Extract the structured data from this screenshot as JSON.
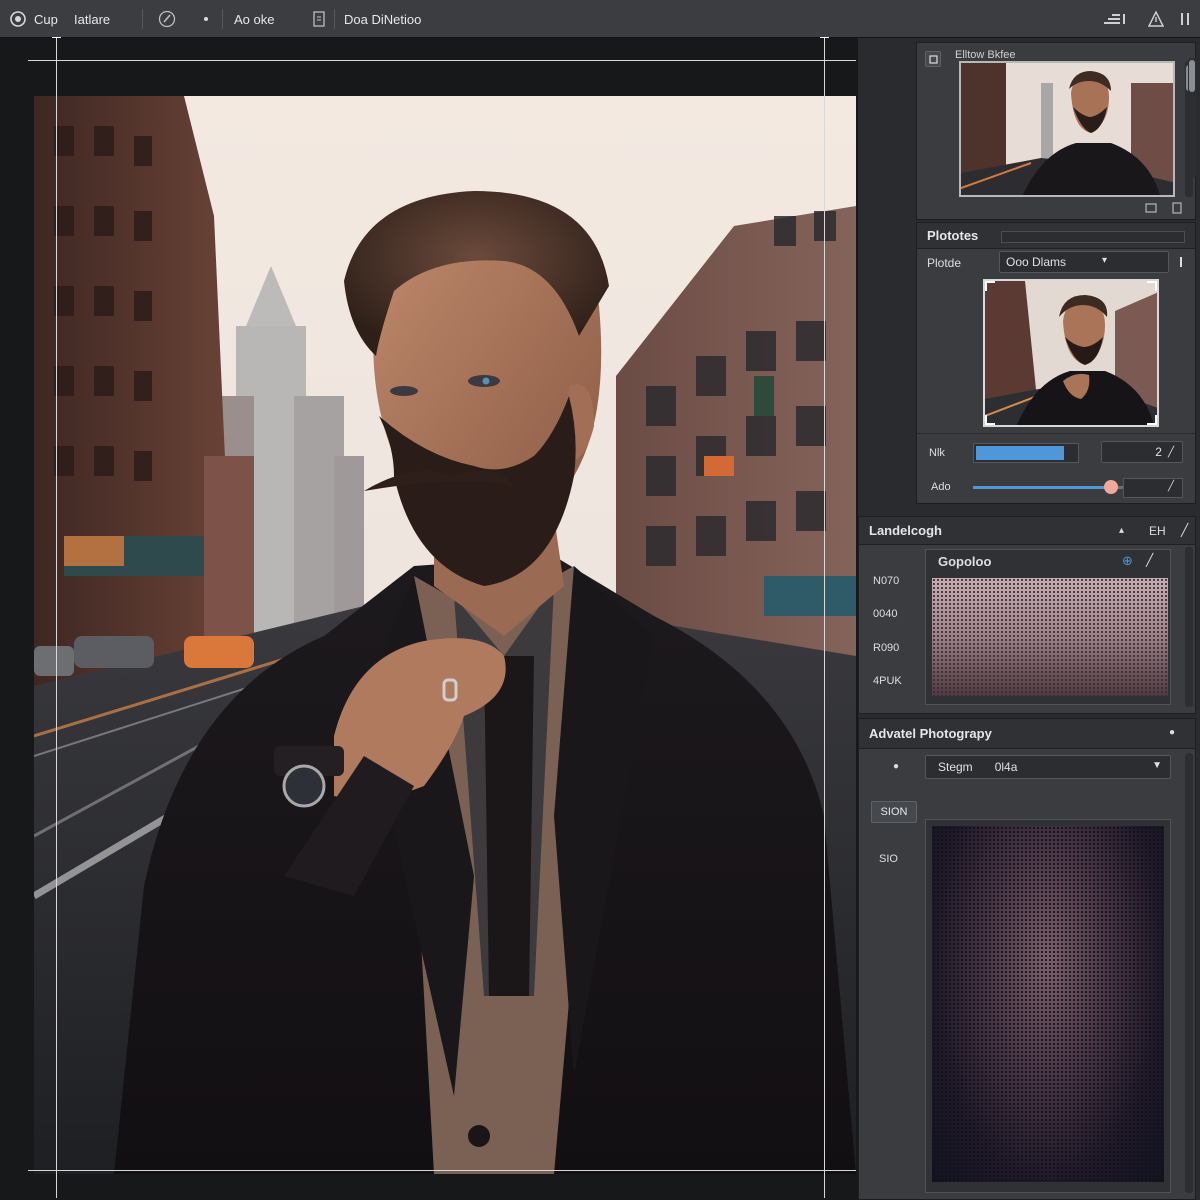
{
  "toolbar": {
    "items": [
      "Cup",
      "Iatlare",
      "Ao oke",
      "Doa DiNetioo"
    ]
  },
  "navigator": {
    "title": "Elltow Bkfee"
  },
  "properties": {
    "title": "Plototes",
    "row_label": "Plotde",
    "dropdown_value": "Ooo Dlams",
    "field1_label": "Nlk",
    "field1_value": "2",
    "field2_label": "Ado",
    "slider_fraction": 0.78
  },
  "landscape": {
    "title": "Landelcogh",
    "header_right_label": "EH",
    "swatch_label": "Gopoloo",
    "side_labels": [
      "N070",
      "0040",
      "R090",
      "4PUK"
    ]
  },
  "adjust": {
    "title": "Advatel Photograpy",
    "dropdown_label": "Stegm",
    "dropdown_value": "0l4a",
    "button_label": "SION",
    "side_label": "SIO"
  },
  "colors": {
    "accent": "#4f97d8",
    "slider_knob": "#f0a89a",
    "panel": "#3a3c3f",
    "toolbar": "#3b3d40"
  }
}
